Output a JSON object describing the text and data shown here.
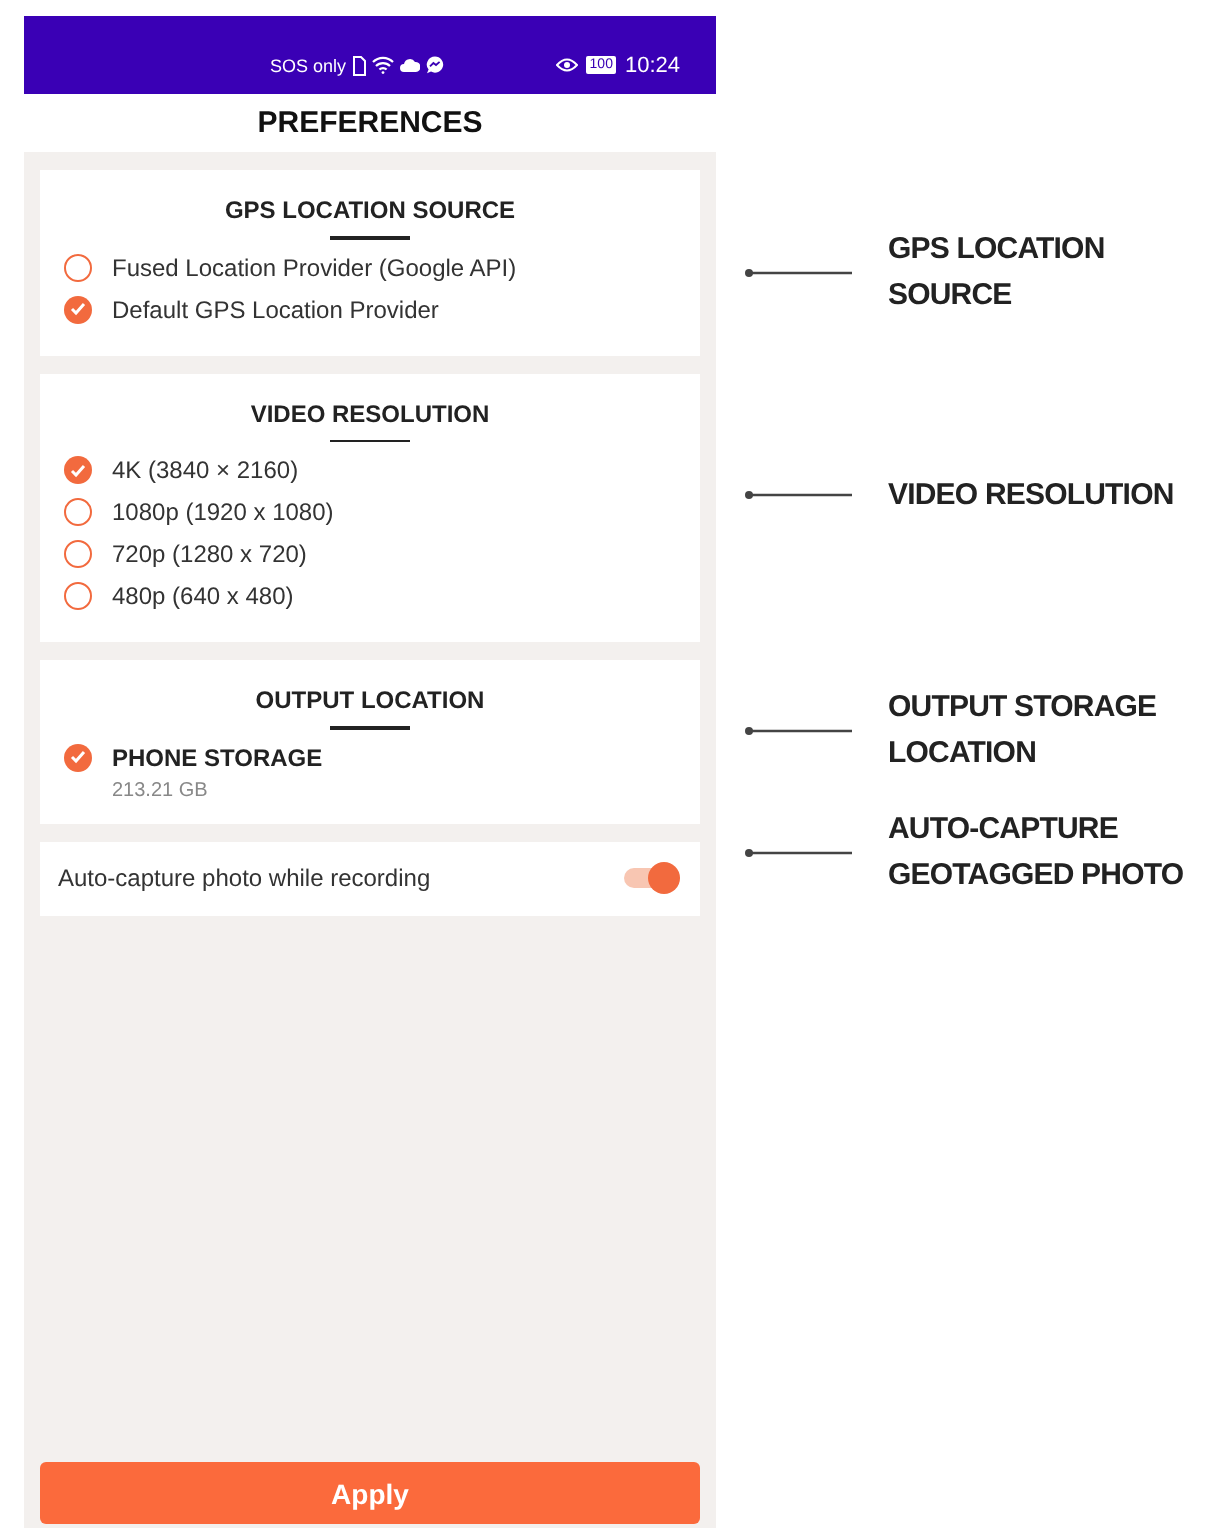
{
  "status_bar": {
    "carrier": "SOS only",
    "battery": "100",
    "time": "10:24"
  },
  "title": "PREFERENCES",
  "sections": [
    {
      "title": "GPS LOCATION SOURCE",
      "options": [
        {
          "label": "Fused Location Provider (Google API)",
          "selected": false
        },
        {
          "label": "Default GPS Location Provider",
          "selected": true
        }
      ]
    },
    {
      "title": "VIDEO RESOLUTION",
      "options": [
        {
          "label": "4K (3840 × 2160)",
          "selected": true
        },
        {
          "label": "1080p (1920 x 1080)",
          "selected": false
        },
        {
          "label": "720p (1280 x 720)",
          "selected": false
        },
        {
          "label": "480p (640 x 480)",
          "selected": false
        }
      ]
    },
    {
      "title": "OUTPUT LOCATION",
      "options": [
        {
          "label": "PHONE STORAGE",
          "detail": "213.21 GB",
          "selected": true
        }
      ]
    }
  ],
  "toggle": {
    "label": "Auto-capture photo while recording",
    "on": true
  },
  "apply_button": "Apply",
  "callouts": [
    {
      "text": "GPS LOCATION\nSOURCE"
    },
    {
      "text": "VIDEO RESOLUTION"
    },
    {
      "text": "OUTPUT STORAGE\nLOCATION"
    },
    {
      "text": "AUTO-CAPTURE\nGEOTAGGED PHOTO"
    }
  ]
}
